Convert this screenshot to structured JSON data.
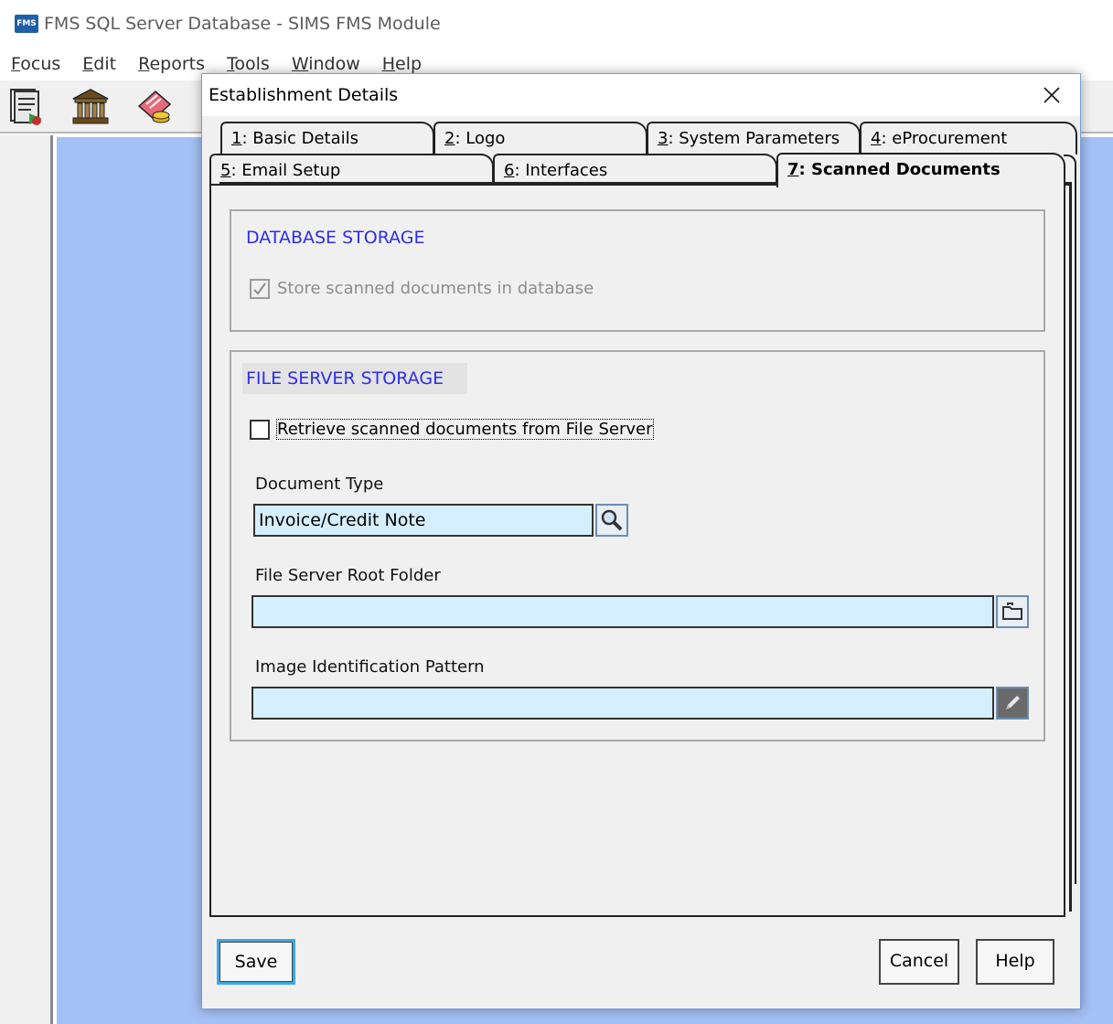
{
  "app": {
    "logo_text": "FMS",
    "title": "FMS SQL Server Database - SIMS FMS Module"
  },
  "menu": [
    {
      "mnemonic": "F",
      "rest": "ocus"
    },
    {
      "mnemonic": "E",
      "rest": "dit"
    },
    {
      "mnemonic": "R",
      "rest": "eports"
    },
    {
      "mnemonic": "T",
      "rest": "ools"
    },
    {
      "mnemonic": "W",
      "rest": "indow"
    },
    {
      "mnemonic": "H",
      "rest": "elp"
    }
  ],
  "dialog": {
    "title": "Establishment Details",
    "tabs": [
      {
        "mnemonic": "1",
        "rest": ": Basic Details"
      },
      {
        "mnemonic": "2",
        "rest": ": Logo"
      },
      {
        "mnemonic": "3",
        "rest": ": System Parameters"
      },
      {
        "mnemonic": "4",
        "rest": ": eProcurement"
      },
      {
        "mnemonic": "5",
        "rest": ": Email Setup"
      },
      {
        "mnemonic": "6",
        "rest": ": Interfaces"
      },
      {
        "mnemonic": "7",
        "rest": ": Scanned Documents"
      }
    ],
    "active_tab": "7: Scanned Documents",
    "database_storage": {
      "title": "DATABASE STORAGE",
      "store_checkbox_label": "Store scanned documents in database",
      "store_checked": true,
      "store_enabled": false
    },
    "file_server_storage": {
      "title": "FILE SERVER STORAGE",
      "retrieve_checkbox_label": "Retrieve scanned documents from File Server",
      "retrieve_checked": false,
      "document_type_label": "Document Type",
      "document_type_value": "Invoice/Credit Note",
      "root_folder_label": "File Server Root Folder",
      "root_folder_value": "",
      "pattern_label": "Image Identification Pattern",
      "pattern_value": ""
    },
    "buttons": {
      "save": "Save",
      "cancel": "Cancel",
      "help": "Help"
    }
  },
  "colors": {
    "workspace": "#a3c1f5",
    "group_title": "#2d2df0",
    "field_bg": "#d6efff"
  }
}
